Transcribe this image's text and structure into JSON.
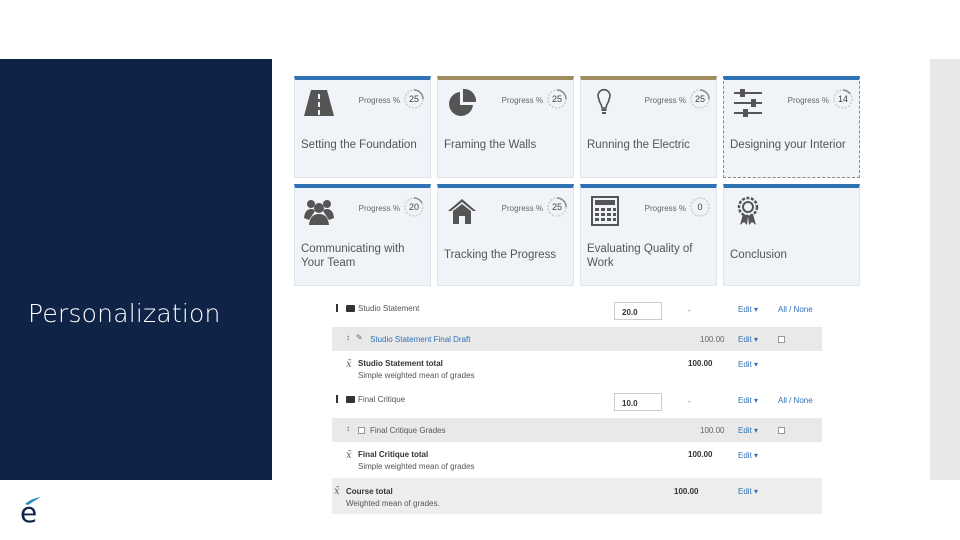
{
  "slide": {
    "title": "Personalization"
  },
  "tile_common": {
    "progress_label": "Progress %"
  },
  "tiles": [
    {
      "label": "Setting the Foundation",
      "progress": "25",
      "icon": "road-icon"
    },
    {
      "label": "Framing the Walls",
      "progress": "25",
      "icon": "pie-chart-icon"
    },
    {
      "label": "Running the Electric",
      "progress": "25",
      "icon": "lightbulb-icon"
    },
    {
      "label": "Designing your Interior",
      "progress": "14",
      "icon": "sliders-icon"
    },
    {
      "label": "Communicating with Your Team",
      "progress": "20",
      "icon": "users-icon"
    },
    {
      "label": "Tracking the Progress",
      "progress": "25",
      "icon": "home-icon"
    },
    {
      "label": "Evaluating Quality of Work",
      "progress": "0",
      "icon": "calculator-icon"
    },
    {
      "label": "Conclusion",
      "progress": "",
      "icon": "award-icon"
    }
  ],
  "gradebook": {
    "edit_label": "Edit",
    "all_none": "All / None",
    "dash": "-",
    "categories": [
      {
        "name": "Studio Statement",
        "weight": "20.0",
        "item": {
          "name": "Studio Statement Final Draft",
          "max": "100.00"
        },
        "total": {
          "name": "Studio Statement total",
          "desc": "Simple weighted mean of grades",
          "max": "100.00"
        }
      },
      {
        "name": "Final Critique",
        "weight": "10.0",
        "item": {
          "name": "Final Critique Grades",
          "max": "100.00"
        },
        "total": {
          "name": "Final Critique total",
          "desc": "Simple weighted mean of grades",
          "max": "100.00"
        }
      }
    ],
    "course_total": {
      "name": "Course total",
      "desc": "Weighted mean of grades.",
      "max": "100.00"
    }
  }
}
